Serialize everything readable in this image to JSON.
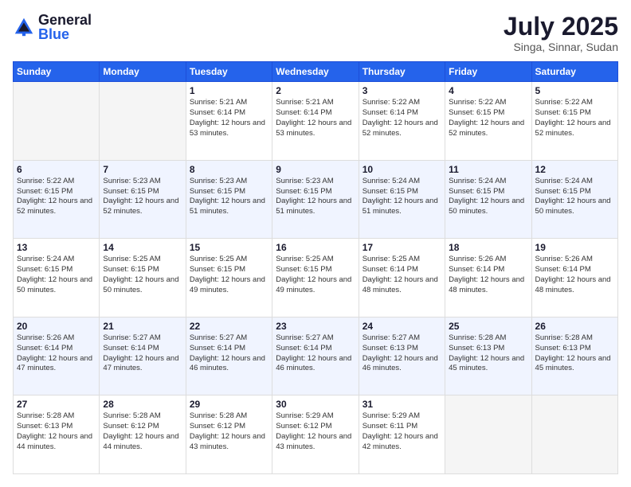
{
  "logo": {
    "general": "General",
    "blue": "Blue"
  },
  "title": "July 2025",
  "location": "Singa, Sinnar, Sudan",
  "weekdays": [
    "Sunday",
    "Monday",
    "Tuesday",
    "Wednesday",
    "Thursday",
    "Friday",
    "Saturday"
  ],
  "weeks": [
    [
      {
        "day": "",
        "empty": true
      },
      {
        "day": "",
        "empty": true
      },
      {
        "day": "1",
        "sunrise": "5:21 AM",
        "sunset": "6:14 PM",
        "daylight": "12 hours and 53 minutes."
      },
      {
        "day": "2",
        "sunrise": "5:21 AM",
        "sunset": "6:14 PM",
        "daylight": "12 hours and 53 minutes."
      },
      {
        "day": "3",
        "sunrise": "5:22 AM",
        "sunset": "6:14 PM",
        "daylight": "12 hours and 52 minutes."
      },
      {
        "day": "4",
        "sunrise": "5:22 AM",
        "sunset": "6:15 PM",
        "daylight": "12 hours and 52 minutes."
      },
      {
        "day": "5",
        "sunrise": "5:22 AM",
        "sunset": "6:15 PM",
        "daylight": "12 hours and 52 minutes."
      }
    ],
    [
      {
        "day": "6",
        "sunrise": "5:22 AM",
        "sunset": "6:15 PM",
        "daylight": "12 hours and 52 minutes."
      },
      {
        "day": "7",
        "sunrise": "5:23 AM",
        "sunset": "6:15 PM",
        "daylight": "12 hours and 52 minutes."
      },
      {
        "day": "8",
        "sunrise": "5:23 AM",
        "sunset": "6:15 PM",
        "daylight": "12 hours and 51 minutes."
      },
      {
        "day": "9",
        "sunrise": "5:23 AM",
        "sunset": "6:15 PM",
        "daylight": "12 hours and 51 minutes."
      },
      {
        "day": "10",
        "sunrise": "5:24 AM",
        "sunset": "6:15 PM",
        "daylight": "12 hours and 51 minutes."
      },
      {
        "day": "11",
        "sunrise": "5:24 AM",
        "sunset": "6:15 PM",
        "daylight": "12 hours and 50 minutes."
      },
      {
        "day": "12",
        "sunrise": "5:24 AM",
        "sunset": "6:15 PM",
        "daylight": "12 hours and 50 minutes."
      }
    ],
    [
      {
        "day": "13",
        "sunrise": "5:24 AM",
        "sunset": "6:15 PM",
        "daylight": "12 hours and 50 minutes."
      },
      {
        "day": "14",
        "sunrise": "5:25 AM",
        "sunset": "6:15 PM",
        "daylight": "12 hours and 50 minutes."
      },
      {
        "day": "15",
        "sunrise": "5:25 AM",
        "sunset": "6:15 PM",
        "daylight": "12 hours and 49 minutes."
      },
      {
        "day": "16",
        "sunrise": "5:25 AM",
        "sunset": "6:15 PM",
        "daylight": "12 hours and 49 minutes."
      },
      {
        "day": "17",
        "sunrise": "5:25 AM",
        "sunset": "6:14 PM",
        "daylight": "12 hours and 48 minutes."
      },
      {
        "day": "18",
        "sunrise": "5:26 AM",
        "sunset": "6:14 PM",
        "daylight": "12 hours and 48 minutes."
      },
      {
        "day": "19",
        "sunrise": "5:26 AM",
        "sunset": "6:14 PM",
        "daylight": "12 hours and 48 minutes."
      }
    ],
    [
      {
        "day": "20",
        "sunrise": "5:26 AM",
        "sunset": "6:14 PM",
        "daylight": "12 hours and 47 minutes."
      },
      {
        "day": "21",
        "sunrise": "5:27 AM",
        "sunset": "6:14 PM",
        "daylight": "12 hours and 47 minutes."
      },
      {
        "day": "22",
        "sunrise": "5:27 AM",
        "sunset": "6:14 PM",
        "daylight": "12 hours and 46 minutes."
      },
      {
        "day": "23",
        "sunrise": "5:27 AM",
        "sunset": "6:14 PM",
        "daylight": "12 hours and 46 minutes."
      },
      {
        "day": "24",
        "sunrise": "5:27 AM",
        "sunset": "6:13 PM",
        "daylight": "12 hours and 46 minutes."
      },
      {
        "day": "25",
        "sunrise": "5:28 AM",
        "sunset": "6:13 PM",
        "daylight": "12 hours and 45 minutes."
      },
      {
        "day": "26",
        "sunrise": "5:28 AM",
        "sunset": "6:13 PM",
        "daylight": "12 hours and 45 minutes."
      }
    ],
    [
      {
        "day": "27",
        "sunrise": "5:28 AM",
        "sunset": "6:13 PM",
        "daylight": "12 hours and 44 minutes."
      },
      {
        "day": "28",
        "sunrise": "5:28 AM",
        "sunset": "6:12 PM",
        "daylight": "12 hours and 44 minutes."
      },
      {
        "day": "29",
        "sunrise": "5:28 AM",
        "sunset": "6:12 PM",
        "daylight": "12 hours and 43 minutes."
      },
      {
        "day": "30",
        "sunrise": "5:29 AM",
        "sunset": "6:12 PM",
        "daylight": "12 hours and 43 minutes."
      },
      {
        "day": "31",
        "sunrise": "5:29 AM",
        "sunset": "6:11 PM",
        "daylight": "12 hours and 42 minutes."
      },
      {
        "day": "",
        "empty": true
      },
      {
        "day": "",
        "empty": true
      }
    ]
  ]
}
